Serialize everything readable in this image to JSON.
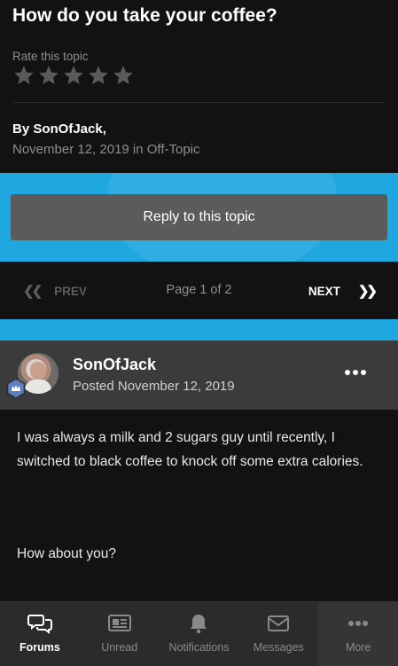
{
  "topic": {
    "title": "How do you take your coffee?",
    "rate_label": "Rate this topic",
    "star_count": 5,
    "by_label": "By SonOfJack,",
    "date_prefix": "November 12, 2019 in ",
    "forum": "Off-Topic"
  },
  "reply_button": "Reply to this topic",
  "pagination": {
    "prev": "PREV",
    "page_info": "Page 1 of 2",
    "next": "NEXT"
  },
  "post": {
    "author": "SonOfJack",
    "posted": "Posted November 12, 2019",
    "paragraph1": "I was always a milk and 2 sugars guy until recently, I switched to black coffee to knock off some extra calories.",
    "paragraph2": "How about you?"
  },
  "tabs": [
    {
      "label": "Forums",
      "icon": "forums-icon",
      "active": true
    },
    {
      "label": "Unread",
      "icon": "unread-icon"
    },
    {
      "label": "Notifications",
      "icon": "bell-icon"
    },
    {
      "label": "Messages",
      "icon": "envelope-icon"
    },
    {
      "label": "More",
      "icon": "more-dots-icon"
    }
  ],
  "colors": {
    "accent": "#1fa8e0",
    "background": "#121212",
    "button": "#5b5b5b",
    "post_header": "#3b3b3b"
  }
}
